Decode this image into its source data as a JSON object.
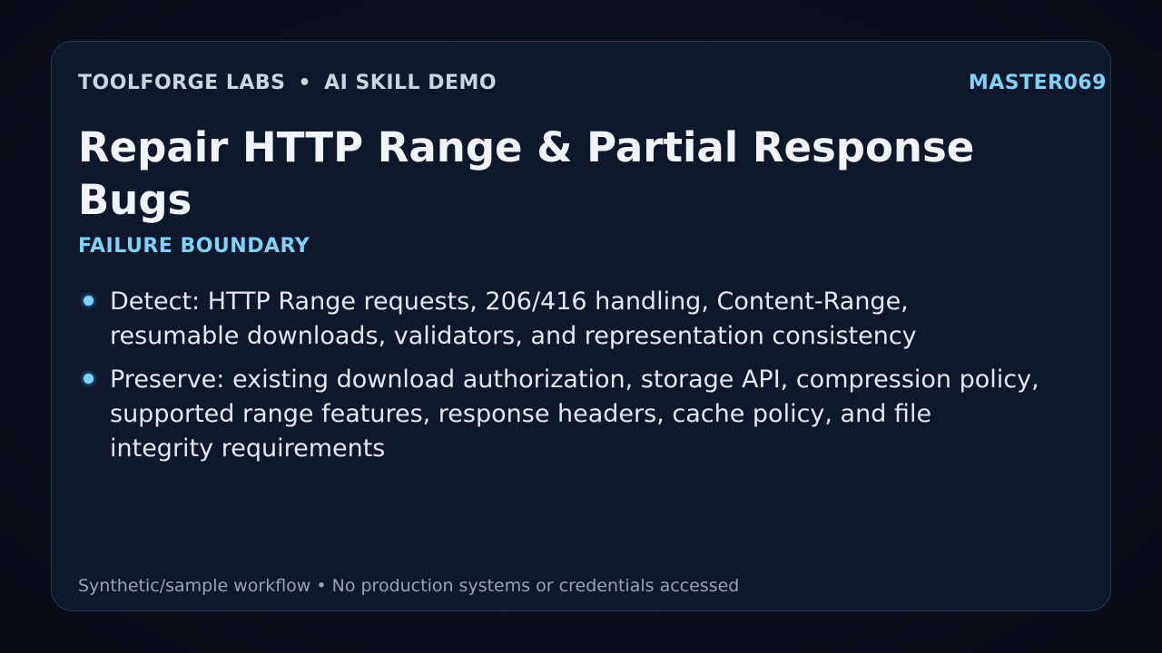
{
  "header": {
    "brand": "TOOLFORGE LABS",
    "separator": "•",
    "subtitle": "AI SKILL DEMO",
    "code": "MASTER069"
  },
  "title": "Repair HTTP Range & Partial Response Bugs",
  "section_label": "FAILURE BOUNDARY",
  "bullets": [
    {
      "text": "Detect: HTTP Range requests, 206/416 handling, Content-Range, resumable downloads, validators, and representation consistency"
    },
    {
      "text": "Preserve: existing download authorization, storage API, compression policy, supported range features, response headers, cache policy, and file integrity requirements"
    }
  ],
  "footer": "Synthetic/sample workflow • No production systems or credentials accessed",
  "colors": {
    "accent": "#7dd3fc",
    "card_background": "#0f172a",
    "card_border": "#2a3a52",
    "title": "#f1f5f9",
    "body_text": "#e2e8f0",
    "muted": "#94a3b8"
  }
}
